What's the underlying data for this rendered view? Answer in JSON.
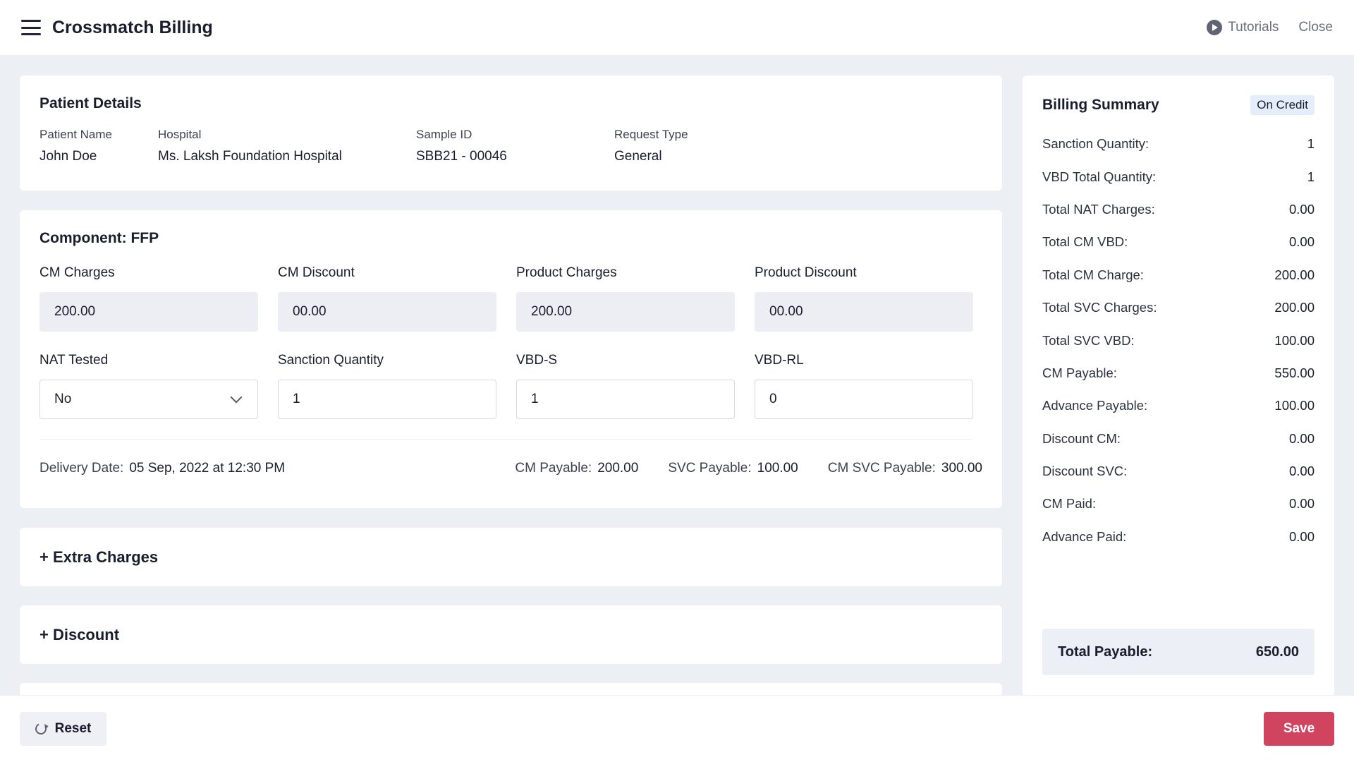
{
  "header": {
    "title": "Crossmatch Billing",
    "tutorials_label": "Tutorials",
    "close_label": "Close"
  },
  "patient": {
    "title": "Patient Details",
    "fields": [
      {
        "label": "Patient Name",
        "value": "John Doe"
      },
      {
        "label": "Hospital",
        "value": "Ms. Laksh Foundation Hospital"
      },
      {
        "label": "Sample ID",
        "value": "SBB21 - 00046"
      },
      {
        "label": "Request Type",
        "value": "General"
      }
    ]
  },
  "component": {
    "title": "Component: FFP",
    "cm_charges": {
      "label": "CM Charges",
      "value": "200.00"
    },
    "cm_discount": {
      "label": "CM Discount",
      "value": "00.00"
    },
    "product_charges": {
      "label": "Product Charges",
      "value": "200.00"
    },
    "product_discount": {
      "label": "Product Discount",
      "value": "00.00"
    },
    "nat_tested": {
      "label": "NAT Tested",
      "value": "No"
    },
    "sanction_quantity": {
      "label": "Sanction Quantity",
      "value": "1"
    },
    "vbd_s": {
      "label": "VBD-S",
      "value": "1"
    },
    "vbd_rl": {
      "label": "VBD-RL",
      "value": "0"
    },
    "delivery_date_label": "Delivery Date:",
    "delivery_date_value": "05 Sep, 2022 at 12:30 PM",
    "cm_payable_label": "CM Payable:",
    "cm_payable_value": "200.00",
    "svc_payable_label": "SVC Payable:",
    "svc_payable_value": "100.00",
    "cm_svc_payable_label": "CM SVC Payable:",
    "cm_svc_payable_value": "300.00"
  },
  "sections": {
    "extra_charges": "+ Extra Charges",
    "discount": "+ Discount"
  },
  "summary": {
    "title": "Billing Summary",
    "badge": "On Credit",
    "rows": [
      {
        "label": "Sanction Quantity:",
        "value": "1"
      },
      {
        "label": "VBD Total Quantity:",
        "value": "1"
      },
      {
        "label": "Total NAT Charges:",
        "value": "0.00"
      },
      {
        "label": "Total CM VBD:",
        "value": "0.00"
      },
      {
        "label": "Total CM Charge:",
        "value": "200.00"
      },
      {
        "label": "Total SVC Charges:",
        "value": "200.00"
      },
      {
        "label": "Total SVC VBD:",
        "value": "100.00"
      },
      {
        "label": "CM Payable:",
        "value": "550.00"
      },
      {
        "label": "Advance Payable:",
        "value": "100.00"
      },
      {
        "label": "Discount CM:",
        "value": "0.00"
      },
      {
        "label": "Discount SVC:",
        "value": "0.00"
      },
      {
        "label": "CM Paid:",
        "value": "0.00"
      },
      {
        "label": "Advance Paid:",
        "value": "0.00"
      }
    ],
    "total_label": "Total Payable:",
    "total_value": "650.00"
  },
  "footer": {
    "reset_label": "Reset",
    "save_label": "Save"
  },
  "colors": {
    "save": "#d1445f",
    "background": "#eceff4",
    "badge": "#e3eefa"
  }
}
